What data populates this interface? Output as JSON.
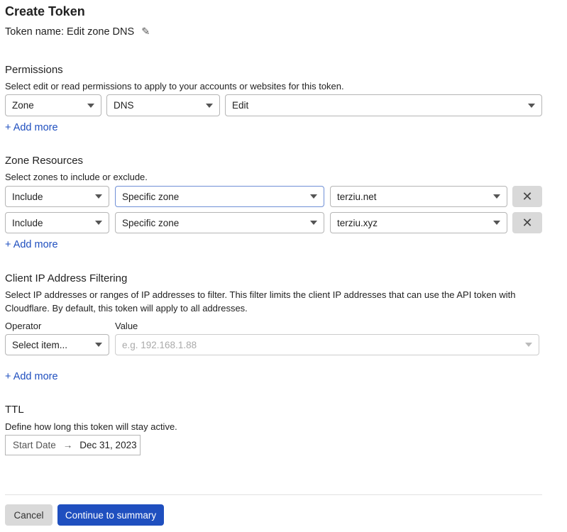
{
  "title": "Create Token",
  "token_name": "Token name: Edit zone DNS",
  "permissions": {
    "heading": "Permissions",
    "description": "Select edit or read permissions to apply to your accounts or websites for this token.",
    "selects": [
      "Zone",
      "DNS",
      "Edit"
    ],
    "add_more": "+ Add more"
  },
  "zone_resources": {
    "heading": "Zone Resources",
    "description": "Select zones to include or exclude.",
    "rows": [
      [
        "Include",
        "Specific zone",
        "terziu.net"
      ],
      [
        "Include",
        "Specific zone",
        "terziu.xyz"
      ]
    ],
    "add_more": "+ Add more",
    "remove": "✕"
  },
  "ip_filtering": {
    "heading": "Client IP Address Filtering",
    "description_1": "Select IP addresses or ranges of IP addresses to filter. This filter limits the client IP addresses that can use the API token with",
    "description_2": "Cloudflare. By default, this token will apply to all addresses.",
    "operator_label": "Operator",
    "value_label": "Value",
    "operator_value": "Select item...",
    "value_placeholder": "e.g. 192.168.1.88",
    "add_more": "+ Add more"
  },
  "ttl": {
    "heading": "TTL",
    "description": "Define how long this token will stay active.",
    "start": "Start Date",
    "arrow": "→",
    "end": "Dec 31, 2023"
  },
  "buttons": {
    "cancel": "Cancel",
    "continue": "Continue to summary"
  },
  "colors": {
    "primary": "#1f4fbf",
    "cancel_bg": "#d9d9d9"
  }
}
